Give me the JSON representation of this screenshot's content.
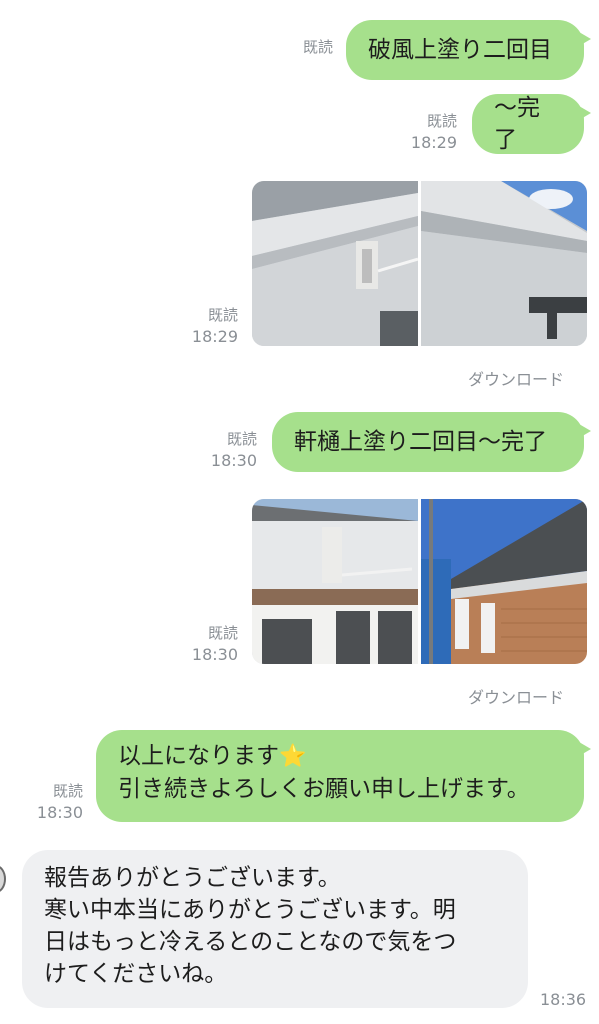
{
  "messages": {
    "m1": {
      "read": "既読",
      "text": "破風上塗り二回目"
    },
    "m2": {
      "read": "既読",
      "time": "18:29",
      "text": "～完了"
    },
    "m3": {
      "read": "既読",
      "time": "18:29",
      "download": "ダウンロード"
    },
    "m4": {
      "read": "既読",
      "time": "18:30",
      "text": "軒樋上塗り二回目～完了"
    },
    "m5": {
      "read": "既読",
      "time": "18:30",
      "download": "ダウンロード"
    },
    "m6": {
      "read": "既読",
      "time": "18:30",
      "line1": "以上になります",
      "line2": "引き続きよろしくお願い申し上げます。",
      "emoji": "⭐"
    },
    "m7": {
      "time": "18:36",
      "line1": "報告ありがとうございます。",
      "line2": "寒い中本当にありがとうございます。明",
      "line3": "日はもっと冷えるとのことなので気をつ",
      "line4": "けてくださいね。"
    }
  },
  "colors": {
    "outgoing_bubble": "#a6e08c",
    "incoming_bubble": "#eff0f2",
    "meta_text": "#8a8f95"
  }
}
